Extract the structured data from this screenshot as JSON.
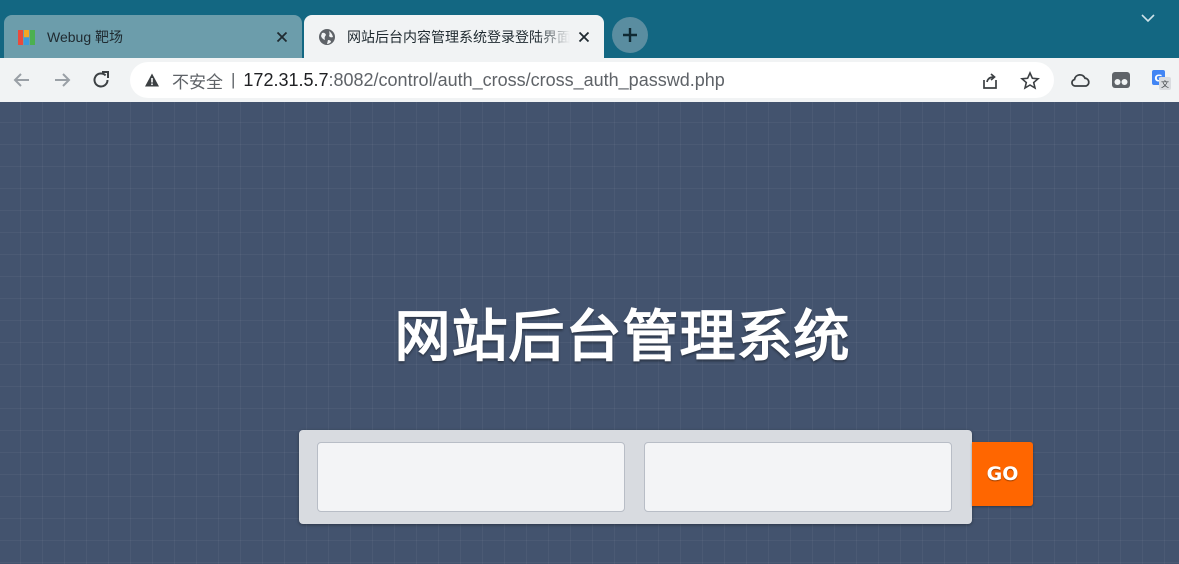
{
  "browser": {
    "tabs": [
      {
        "title": "Webug 靶场",
        "active": false,
        "favicon": "webug-favicon"
      },
      {
        "title": "网站后台内容管理系统登录登陆界面",
        "active": true,
        "favicon": "globe-icon"
      }
    ],
    "security_label": "不安全",
    "separator": "|",
    "url_host": "172.31.5.7",
    "url_rest": ":8082/control/auth_cross/cross_auth_passwd.php"
  },
  "page": {
    "heading": "网站后台管理系统",
    "username_value": "",
    "password_value": "",
    "go_label": "GO"
  },
  "colors": {
    "tabstrip": "#136782",
    "page_background": "#43536e",
    "go_button": "#ff6600"
  }
}
